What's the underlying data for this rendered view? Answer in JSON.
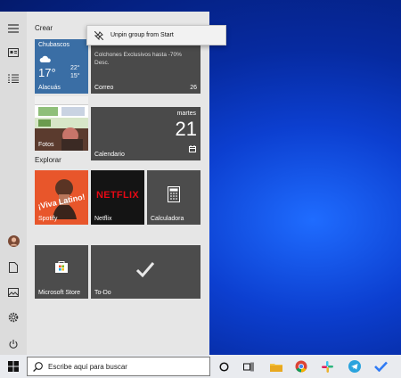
{
  "start_menu": {
    "group_create": "Crear",
    "group_explore": "Explorar",
    "weather": {
      "city": "Chubascos",
      "temp": "17°",
      "high": "22°",
      "low": "15°",
      "location": "Alacuás"
    },
    "mail": {
      "text_line1": "Colchones Exclusivos hasta -70%",
      "text_line2": "Desc.",
      "label": "Correo",
      "count": "26"
    },
    "photos": {
      "label": "Fotos"
    },
    "calendar": {
      "day_name": "martes",
      "day_number": "21",
      "label": "Calendario"
    },
    "spotify": {
      "art_text": "¡Viva Latino!",
      "label": "Spotify"
    },
    "netflix": {
      "logo": "NETFLIX",
      "label": "Netflix"
    },
    "calculator": {
      "label": "Calculadora"
    },
    "store": {
      "label": "Microsoft Store"
    },
    "todo": {
      "label": "To-Do"
    }
  },
  "context_menu": {
    "item": "Unpin group from Start"
  },
  "taskbar": {
    "search_placeholder": "Escribe aquí para buscar"
  },
  "colors": {
    "weather_bg": "#3a6ea5",
    "mail_bg": "#4a4a4a",
    "calendar_bg": "#4a4a4a",
    "spotify_bg": "#e8562b",
    "netflix_bg": "#141414",
    "netflix_red": "#e50914",
    "tile_gray": "#4c4c4c",
    "desktop_blue": "#0c3fd0"
  }
}
